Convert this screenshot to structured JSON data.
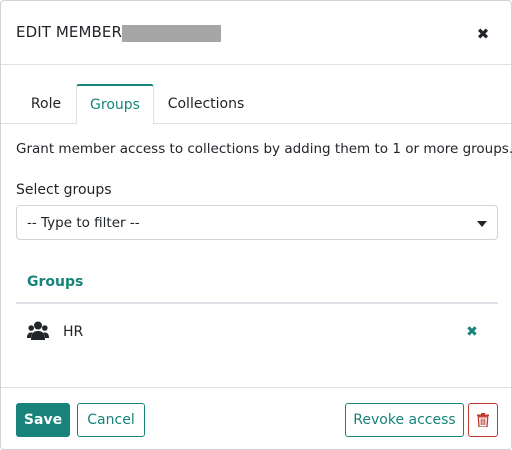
{
  "modal": {
    "title": "EDIT MEMBER",
    "close_icon": "close-icon"
  },
  "tabs": [
    {
      "label": "Role",
      "active": false
    },
    {
      "label": "Groups",
      "active": true
    },
    {
      "label": "Collections",
      "active": false
    }
  ],
  "groups_tab": {
    "description": "Grant member access to collections by adding them to 1 or more groups.",
    "select_label": "Select groups",
    "select_placeholder": "-- Type to filter --",
    "list_heading": "Groups",
    "items": [
      {
        "name": "HR",
        "icon": "users-icon"
      }
    ]
  },
  "footer": {
    "save_label": "Save",
    "cancel_label": "Cancel",
    "revoke_label": "Revoke access",
    "delete_icon": "trash-icon"
  },
  "colors": {
    "accent": "#17837a",
    "danger": "#c0392b",
    "redaction": "#a6a6a6"
  }
}
